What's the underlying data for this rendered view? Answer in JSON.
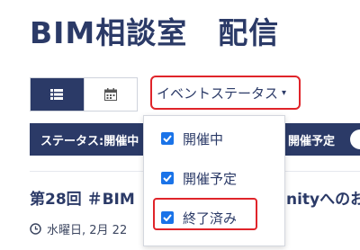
{
  "header": {
    "title": "BIM相談室　配信"
  },
  "view_toggle": {
    "list_icon": "list-icon",
    "calendar_icon": "calendar-icon"
  },
  "status_dropdown": {
    "label": "イベントステータス",
    "caret_icon": "caret-down-icon",
    "caret": "▾"
  },
  "filter_bar": {
    "left_text": "ステータス:開催中",
    "right_text": "開催予定"
  },
  "status_menu": {
    "items": [
      {
        "label": "開催中",
        "checked": true
      },
      {
        "label": "開催予定",
        "checked": true
      },
      {
        "label": "終了済み",
        "checked": true
      }
    ]
  },
  "event": {
    "title_start": "第28回 ＃BIM",
    "title_end": "nityへのお",
    "date": "水曜日, 2月 22"
  },
  "colors": {
    "navy": "#2b3a67",
    "highlight_red": "#e0242a",
    "checkbox_blue": "#1a73e8"
  }
}
